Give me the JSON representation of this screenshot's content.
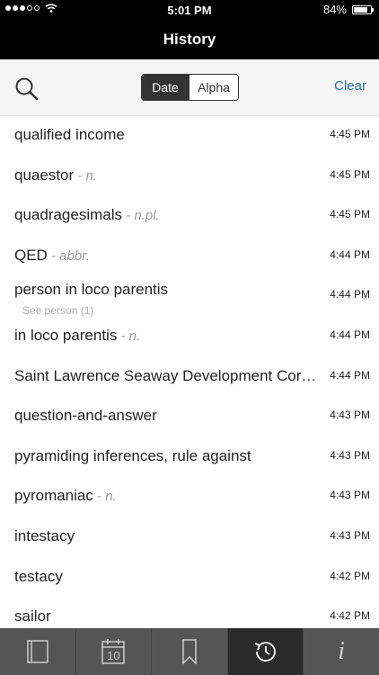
{
  "status": {
    "time": "5:01 PM",
    "battery": "84%",
    "battery_level": 0.84
  },
  "header": {
    "title": "History"
  },
  "toolbar": {
    "segments": [
      {
        "label": "Date"
      },
      {
        "label": "Alpha"
      }
    ],
    "clear_label": "Clear"
  },
  "history": [
    {
      "term": "qualified income",
      "pos": "",
      "sub": "",
      "time": "4:45 PM"
    },
    {
      "term": "quaestor",
      "pos": " - n.",
      "sub": "",
      "time": "4:45 PM"
    },
    {
      "term": "quadragesimals",
      "pos": " - n.pl.",
      "sub": "",
      "time": "4:45 PM"
    },
    {
      "term": "QED",
      "pos": " - abbr.",
      "sub": "",
      "time": "4:44 PM"
    },
    {
      "term": "person in loco parentis",
      "pos": "",
      "sub": "See person (1)",
      "time": "4:44 PM"
    },
    {
      "term": "in loco parentis",
      "pos": " - n.",
      "sub": "",
      "time": "4:44 PM"
    },
    {
      "term": "Saint Lawrence Seaway Development Corp…",
      "pos": "",
      "sub": "",
      "time": "4:44 PM"
    },
    {
      "term": "question-and-answer",
      "pos": "",
      "sub": "",
      "time": "4:43 PM"
    },
    {
      "term": "pyramiding inferences, rule against",
      "pos": "",
      "sub": "",
      "time": "4:43 PM"
    },
    {
      "term": "pyromaniac",
      "pos": " - n.",
      "sub": "",
      "time": "4:43 PM"
    },
    {
      "term": "intestacy",
      "pos": "",
      "sub": "",
      "time": "4:43 PM"
    },
    {
      "term": "testacy",
      "pos": "",
      "sub": "",
      "time": "4:42 PM"
    },
    {
      "term": "sailor",
      "pos": "",
      "sub": "",
      "time": "4:42 PM"
    }
  ],
  "tabs": [
    {
      "icon": "book-icon",
      "label": ""
    },
    {
      "icon": "calendar-icon",
      "label": "10"
    },
    {
      "icon": "bookmark-icon",
      "label": ""
    },
    {
      "icon": "history-icon",
      "label": "",
      "active": true
    },
    {
      "icon": "info-icon",
      "label": "i"
    }
  ]
}
